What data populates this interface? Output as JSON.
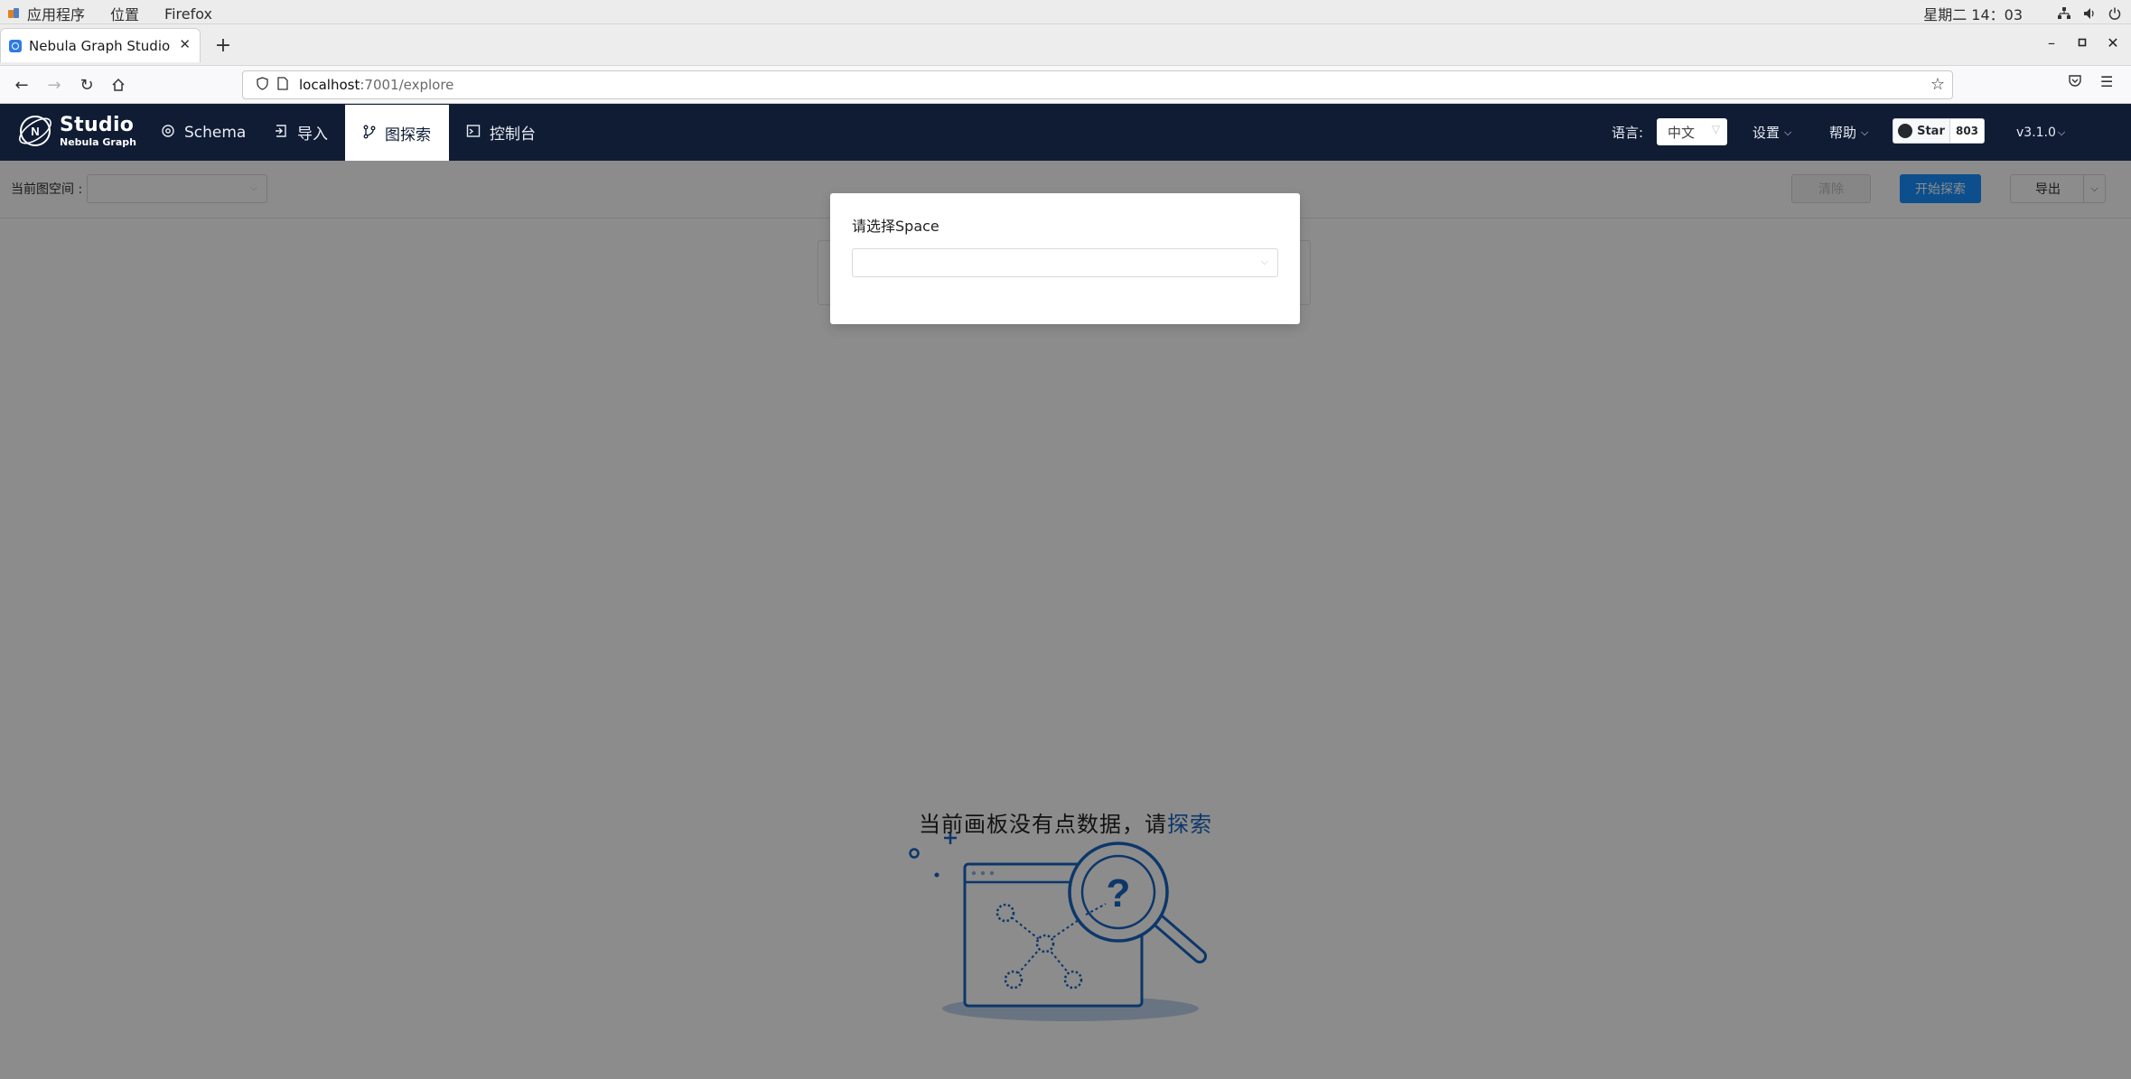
{
  "system_bar": {
    "menus": [
      "应用程序",
      "位置",
      "Firefox"
    ],
    "clock": "星期二 14：03"
  },
  "browser": {
    "tab_title": "Nebula Graph Studio",
    "url_host": "localhost",
    "url_path": ":7001/explore"
  },
  "header": {
    "logo_main": "Studio",
    "logo_sub": "Nebula Graph",
    "nav": [
      {
        "label": "Schema",
        "icon": "schema-icon"
      },
      {
        "label": "导入",
        "icon": "import-icon"
      },
      {
        "label": "图探索",
        "icon": "explore-icon",
        "active": true
      },
      {
        "label": "控制台",
        "icon": "console-icon"
      }
    ],
    "lang_label": "语言:",
    "lang_value": "中文",
    "settings_label": "设置",
    "help_label": "帮助",
    "github_star_label": "Star",
    "github_star_count": "803",
    "version": "v3.1.0"
  },
  "toolbar": {
    "space_label": "当前图空间 :",
    "clear_label": "清除",
    "explore_label": "开始探索",
    "export_label": "导出"
  },
  "empty_state": {
    "message": "当前画板没有点数据，请",
    "link": "探索"
  },
  "modal": {
    "title": "请选择Space",
    "select_value": ""
  },
  "colors": {
    "header_bg": "#0f1c34",
    "primary": "#1890ff",
    "illustration_blue": "#1665c1",
    "overlay": "rgba(0,0,0,0.45)"
  }
}
